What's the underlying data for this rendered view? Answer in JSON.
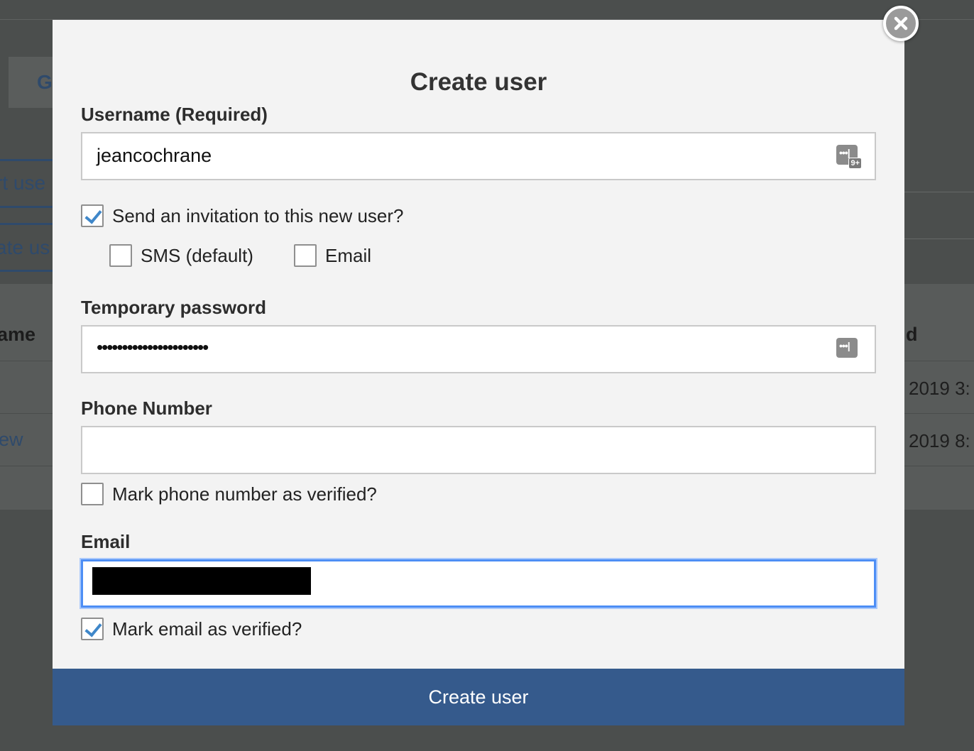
{
  "background": {
    "tab_fragment": "G",
    "link_fragment_1": "rt use",
    "link_fragment_2": "ate us",
    "column_left_fragment": "ame",
    "column_right_fragment": "d",
    "row1_right": "2019 3:",
    "row2_left": "ew",
    "row2_right": "2019 8:"
  },
  "modal": {
    "title": "Create user",
    "username": {
      "label": "Username (Required)",
      "value": "jeancochrane",
      "keyboard_badge": "9+"
    },
    "invitation": {
      "label": "Send an invitation to this new user?",
      "checked": true,
      "sms_label": "SMS (default)",
      "sms_checked": false,
      "email_label": "Email",
      "email_checked": false
    },
    "temp_password": {
      "label": "Temporary password",
      "masked_value": "••••••••••••••••••••••"
    },
    "phone": {
      "label": "Phone Number",
      "value": "",
      "verified_label": "Mark phone number as verified?",
      "verified_checked": false
    },
    "email": {
      "label": "Email",
      "value_redacted": true,
      "verified_label": "Mark email as verified?",
      "verified_checked": true
    },
    "submit_label": "Create user"
  },
  "colors": {
    "primary_button": "#355a8c",
    "check_mark": "#3f87c9",
    "focus_ring": "#4d8ef5",
    "overlay": "#4b4e4d"
  }
}
